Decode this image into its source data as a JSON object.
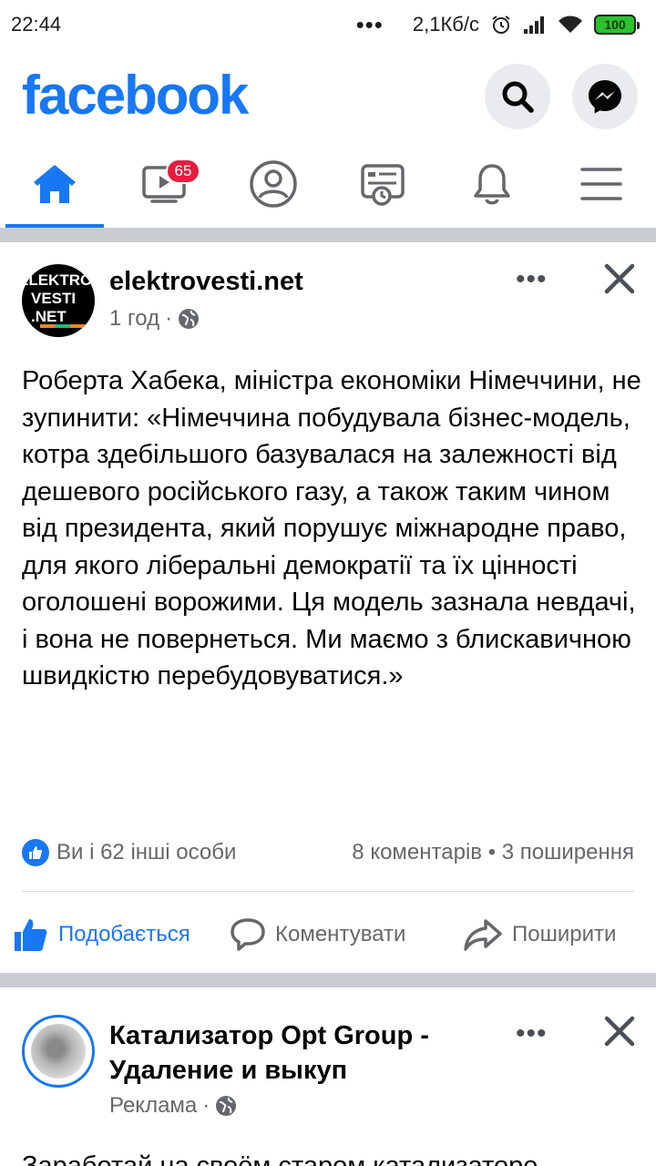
{
  "status_bar": {
    "time": "22:44",
    "dots": "•••",
    "speed": "2,1Кб/с",
    "battery": "100"
  },
  "header": {
    "logo": "facebook"
  },
  "nav": {
    "video_badge": "65"
  },
  "posts": [
    {
      "author": "elektrovesti.net",
      "avatar_text": [
        "ELEKTRO",
        "VESTI",
        ".NET"
      ],
      "time": "1 год",
      "text": "Роберта Хабека, міністра економіки Німеччини, не зупинити: «Німеччина побудувала бізнес-модель, котра здебільшого базувалася на залежності від дешевого російського газу, а також таким чином від президента, який порушує міжнародне право, для якого ліберальні демократії та їх цінності оголошені ворожими. Ця модель зазнала невдачі, і вона не повернеться. Ми маємо з блискавичною швидкістю перебудовуватися.»",
      "reactions": "Ви і 62 інші особи",
      "comments": "8 коментарів",
      "shares": "3 поширення",
      "actions": {
        "like": "Подобається",
        "comment": "Коментувати",
        "share": "Поширити"
      }
    },
    {
      "author_line1": "Катализатор Opt Group -",
      "author_line2": "Удаление и выкуп",
      "sponsored": "Реклама",
      "text": "Заработай на своём старом катализаторе"
    }
  ],
  "colors": {
    "accent": "#1877f2",
    "badge": "#e41e3f",
    "secondary_text": "#65676b",
    "divider": "#c9ccd1"
  },
  "icons": [
    "search-icon",
    "messenger-icon",
    "home-icon",
    "video-icon",
    "profile-icon",
    "news-icon",
    "bell-icon",
    "menu-icon",
    "globe-icon",
    "close-icon",
    "like-icon",
    "comment-icon",
    "share-icon"
  ]
}
